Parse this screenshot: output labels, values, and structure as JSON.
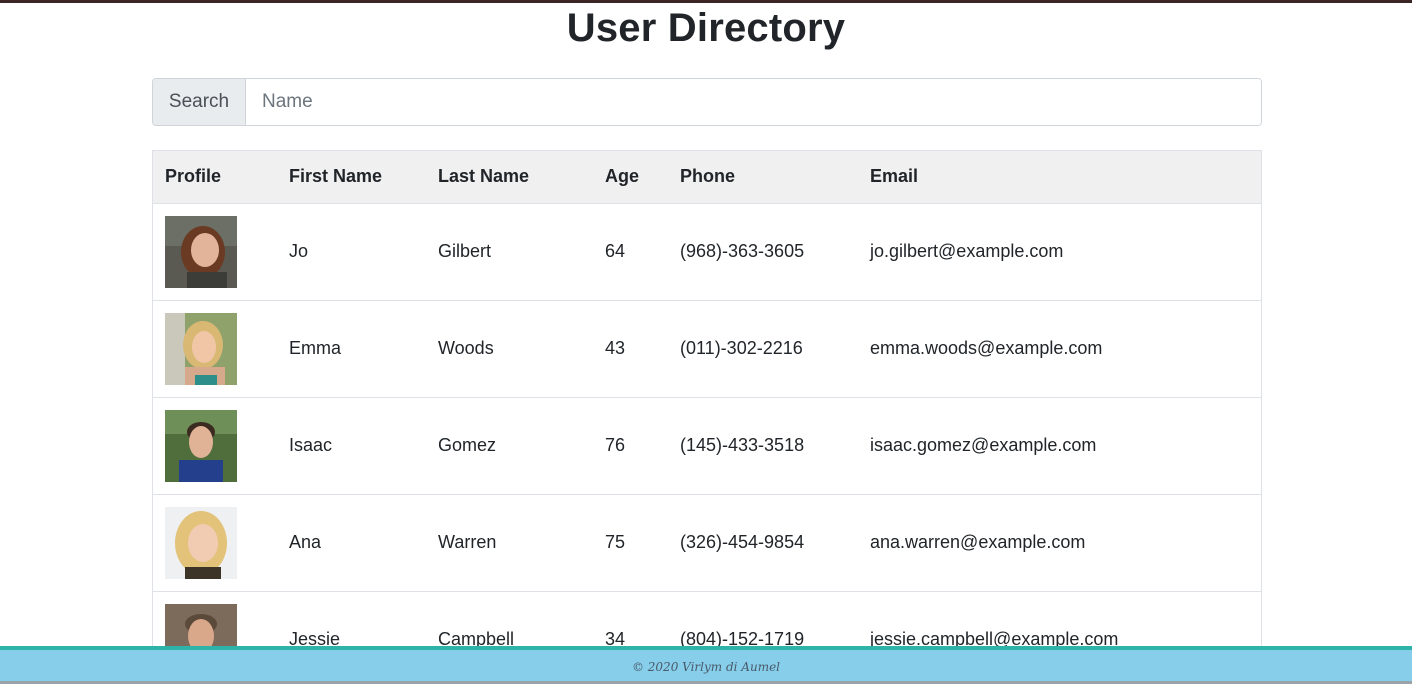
{
  "page": {
    "title": "User Directory"
  },
  "search": {
    "label": "Search",
    "placeholder": "Name",
    "value": ""
  },
  "table": {
    "headers": [
      "Profile",
      "First Name",
      "Last Name",
      "Age",
      "Phone",
      "Email"
    ],
    "rows": [
      {
        "first": "Jo",
        "last": "Gilbert",
        "age": "64",
        "phone": "(968)-363-3605",
        "email": "jo.gilbert@example.com"
      },
      {
        "first": "Emma",
        "last": "Woods",
        "age": "43",
        "phone": "(011)-302-2216",
        "email": "emma.woods@example.com"
      },
      {
        "first": "Isaac",
        "last": "Gomez",
        "age": "76",
        "phone": "(145)-433-3518",
        "email": "isaac.gomez@example.com"
      },
      {
        "first": "Ana",
        "last": "Warren",
        "age": "75",
        "phone": "(326)-454-9854",
        "email": "ana.warren@example.com"
      },
      {
        "first": "Jessie",
        "last": "Campbell",
        "age": "34",
        "phone": "(804)-152-1719",
        "email": "jessie.campbell@example.com"
      }
    ]
  },
  "footer": {
    "text": "© 2020 Virlym di Aumel"
  },
  "colors": {
    "footer_bg": "#87ceeb",
    "footer_border": "#2db3a7",
    "header_row_bg": "#f0f0f0"
  }
}
